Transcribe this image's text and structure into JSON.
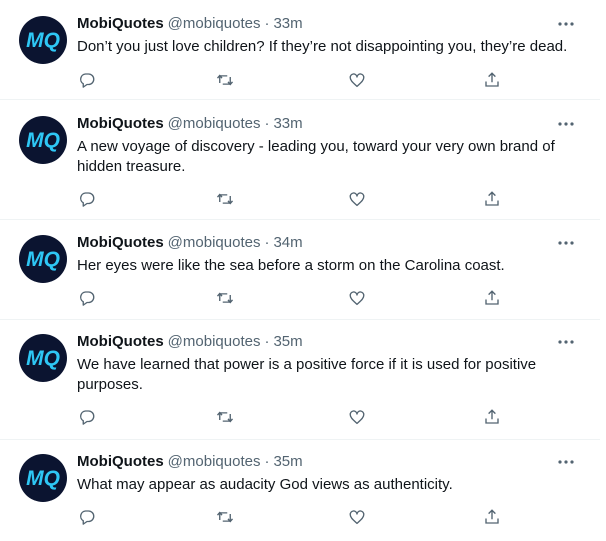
{
  "colors": {
    "text": "#0f1419",
    "secondary": "#536471",
    "divider": "#eff3f4",
    "avatar_bg": "#0b1430",
    "avatar_letters": "#2ec7f5"
  },
  "icons": {
    "more": "more-horizontal-icon",
    "reply": "reply-bubble-icon",
    "retweet": "retweet-arrows-icon",
    "like": "heart-icon",
    "share": "share-upload-icon"
  },
  "avatar": {
    "letters": "MQ"
  },
  "tweets": [
    {
      "name": "MobiQuotes",
      "handle": "@mobiquotes",
      "separator": "·",
      "time": "33m",
      "text": "Don’t you just love children? If they’re not disappointing you, they’re dead."
    },
    {
      "name": "MobiQuotes",
      "handle": "@mobiquotes",
      "separator": "·",
      "time": "33m",
      "text": "A new voyage of discovery - leading you, toward your very own brand of hidden treasure."
    },
    {
      "name": "MobiQuotes",
      "handle": "@mobiquotes",
      "separator": "·",
      "time": "34m",
      "text": "Her eyes were like the sea before a storm on the Carolina coast."
    },
    {
      "name": "MobiQuotes",
      "handle": "@mobiquotes",
      "separator": "·",
      "time": "35m",
      "text": "We have learned that power is a positive force if it is used for positive purposes."
    },
    {
      "name": "MobiQuotes",
      "handle": "@mobiquotes",
      "separator": "·",
      "time": "35m",
      "text": "What may appear as audacity God views as authenticity."
    }
  ]
}
